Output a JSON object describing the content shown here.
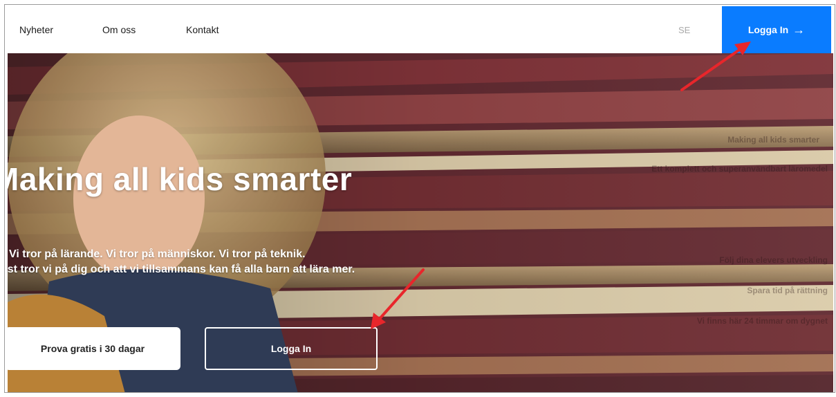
{
  "nav": {
    "items": [
      {
        "label": "Nyheter"
      },
      {
        "label": "Om oss"
      },
      {
        "label": "Kontakt"
      }
    ],
    "language": "SE",
    "login_label": "Logga In",
    "login_icon": "arrow-right-icon"
  },
  "hero": {
    "title": "Making all kids smarter",
    "line1": "Vi tror på lärande. Vi tror på människor. Vi tror på teknik.",
    "line2": "nst tror vi på dig och att vi tillsammans kan få alla barn att lära mer.",
    "try_button": "Prova gratis i 30 dagar",
    "login_button": "Logga In",
    "side_text": [
      "Making all kids smarter",
      "Ett komplett och superanvändbart läromedel",
      "Följ dina elevers utveckling",
      "Spara tid på rättning",
      "Vi finns här 24 timmar om dygnet"
    ]
  },
  "colors": {
    "accent": "#0a7cff",
    "annotation": "#e8262b"
  }
}
